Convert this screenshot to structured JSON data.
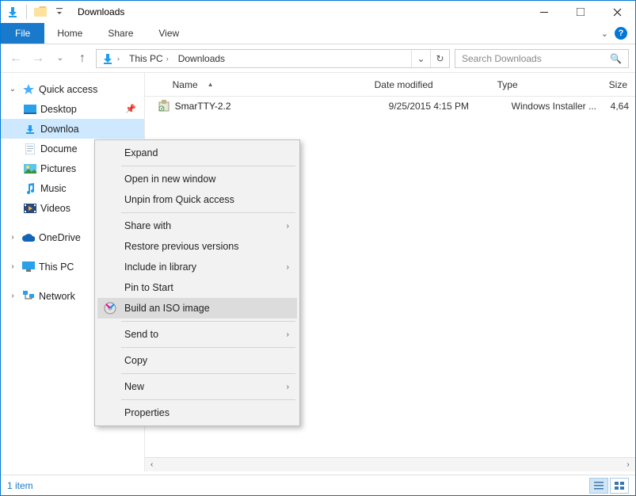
{
  "title": "Downloads",
  "ribbon": {
    "file": "File",
    "tabs": [
      "Home",
      "Share",
      "View"
    ]
  },
  "breadcrumb": [
    "This PC",
    "Downloads"
  ],
  "search_placeholder": "Search Downloads",
  "nav": {
    "quick_access": "Quick access",
    "items": [
      "Desktop",
      "Downloa",
      "Docume",
      "Pictures",
      "Music",
      "Videos"
    ],
    "onedrive": "OneDrive",
    "thispc": "This PC",
    "network": "Network"
  },
  "columns": {
    "name": "Name",
    "date": "Date modified",
    "type": "Type",
    "size": "Size"
  },
  "rows": [
    {
      "name": "SmarTTY-2.2",
      "date": "9/25/2015 4:15 PM",
      "type": "Windows Installer ...",
      "size": "4,64"
    }
  ],
  "menu": {
    "expand": "Expand",
    "open_new": "Open in new window",
    "unpin": "Unpin from Quick access",
    "share": "Share with",
    "restore": "Restore previous versions",
    "include": "Include in library",
    "pin_start": "Pin to Start",
    "build_iso": "Build an ISO image",
    "send_to": "Send to",
    "copy": "Copy",
    "new": "New",
    "properties": "Properties"
  },
  "status": "1 item"
}
